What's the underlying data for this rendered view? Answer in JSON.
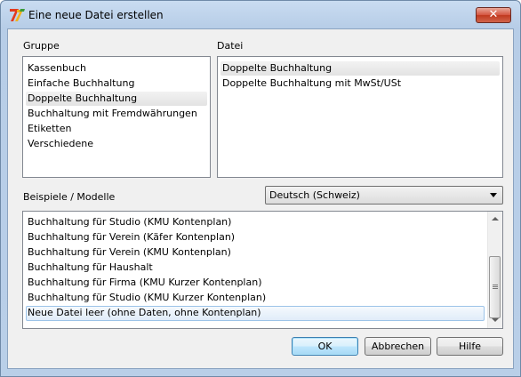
{
  "window": {
    "title": "Eine neue Datei erstellen",
    "close_glyph": "✕"
  },
  "gruppe": {
    "label": "Gruppe",
    "items": [
      "Kassenbuch",
      "Einfache Buchhaltung",
      "Doppelte Buchhaltung",
      "Buchhaltung mit Fremdwährungen",
      "Etiketten",
      "Verschiedene"
    ],
    "selected": "Doppelte Buchhaltung"
  },
  "datei": {
    "label": "Datei",
    "items": [
      "Doppelte Buchhaltung",
      "Doppelte Buchhaltung mit MwSt/USt"
    ],
    "selected": "Doppelte Buchhaltung"
  },
  "beispiele": {
    "label": "Beispiele / Modelle",
    "language_select": "Deutsch (Schweiz)",
    "items": [
      "Buchhaltung für Studio (KMU Kontenplan)",
      "Buchhaltung für Verein (Käfer Kontenplan)",
      "Buchhaltung für Verein (KMU Kontenplan)",
      "Buchhaltung für Haushalt",
      "Buchhaltung für Firma (KMU Kurzer Kontenplan)",
      "Buchhaltung für Studio (KMU Kurzer Kontenplan)",
      "Neue Datei leer (ohne Daten, ohne Kontenplan)"
    ],
    "selected": "Neue Datei leer (ohne Daten, ohne Kontenplan)"
  },
  "buttons": {
    "ok": "OK",
    "cancel": "Abbrechen",
    "help": "Hilfe"
  },
  "icons": {
    "app": "banana-app-icon",
    "close": "close-icon",
    "dropdown": "chevron-down-icon"
  }
}
